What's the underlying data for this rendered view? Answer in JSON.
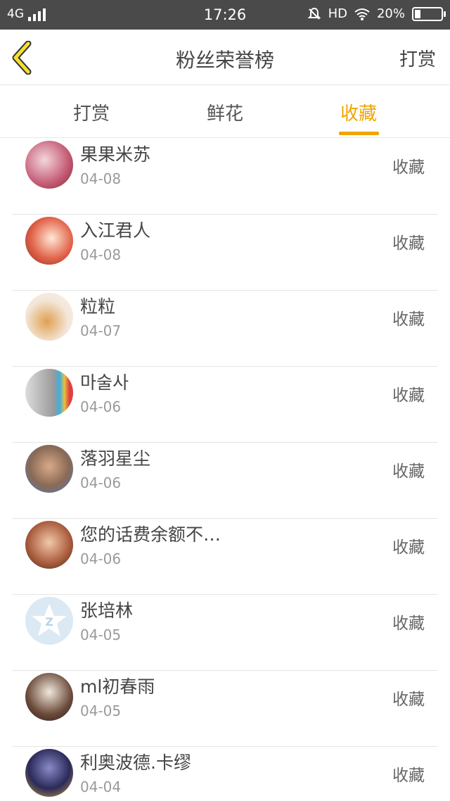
{
  "status_bar": {
    "network": "4G",
    "time": "17:26",
    "hd": "HD",
    "battery": "20%",
    "icons": [
      "signal-icon",
      "mute-bell-icon",
      "wifi-icon",
      "battery-icon"
    ]
  },
  "nav": {
    "title": "粉丝荣誉榜",
    "action": "打赏",
    "back_icon": "chevron-left-icon",
    "accent": "#f0a500"
  },
  "tabs": [
    {
      "label": "打赏",
      "active": false
    },
    {
      "label": "鲜花",
      "active": false
    },
    {
      "label": "收藏",
      "active": true
    }
  ],
  "list": [
    {
      "name": "果果米苏",
      "date": "04-08",
      "action": "收藏"
    },
    {
      "name": "入江君人",
      "date": "04-08",
      "action": "收藏"
    },
    {
      "name": "粒粒",
      "date": "04-07",
      "action": "收藏"
    },
    {
      "name": "마술사",
      "date": "04-06",
      "action": "收藏"
    },
    {
      "name": "落羽星尘",
      "date": "04-06",
      "action": "收藏"
    },
    {
      "name": "您的话费余额不…",
      "date": "04-06",
      "action": "收藏"
    },
    {
      "name": "张培林",
      "date": "04-05",
      "action": "收藏"
    },
    {
      "name": "ml初春雨",
      "date": "04-05",
      "action": "收藏"
    },
    {
      "name": "利奥波德.卡缪",
      "date": "04-04",
      "action": "收藏"
    }
  ]
}
